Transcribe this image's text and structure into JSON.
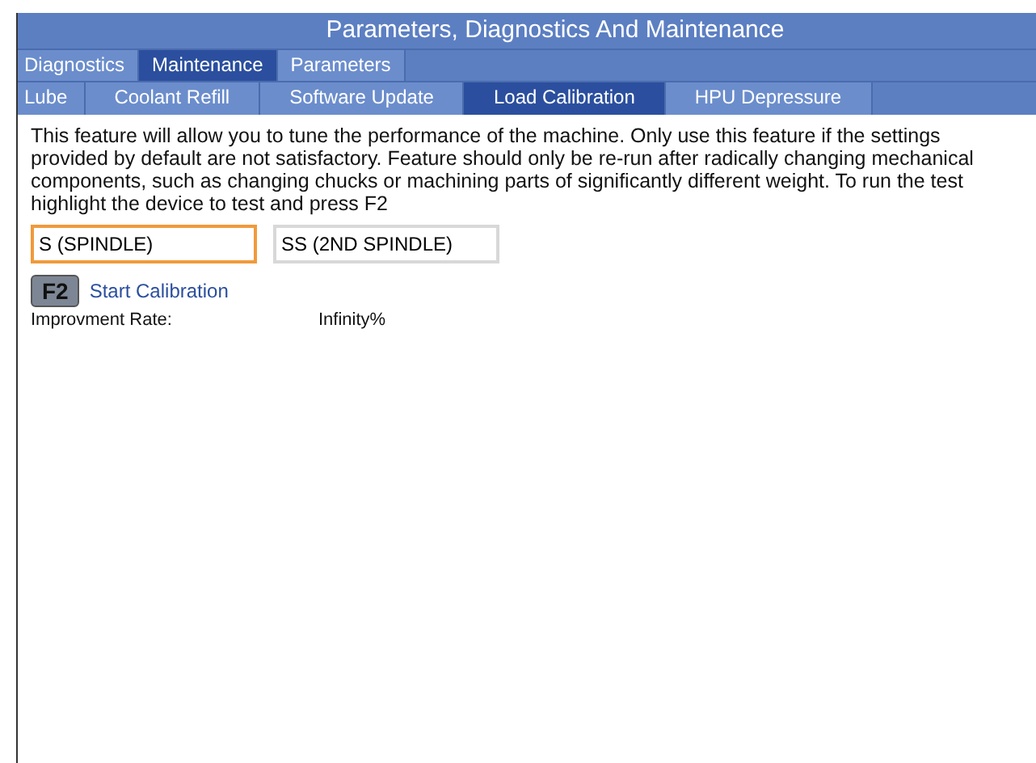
{
  "window": {
    "title": "Parameters, Diagnostics And Maintenance"
  },
  "tabs": [
    {
      "label": "Diagnostics",
      "selected": false
    },
    {
      "label": "Maintenance",
      "selected": true
    },
    {
      "label": "Parameters",
      "selected": false
    }
  ],
  "subtabs": [
    {
      "label": "Lube",
      "selected": false
    },
    {
      "label": "Coolant Refill",
      "selected": false
    },
    {
      "label": "Software Update",
      "selected": false
    },
    {
      "label": "Load Calibration",
      "selected": true
    },
    {
      "label": "HPU Depressure",
      "selected": false
    }
  ],
  "description": "This feature will allow you to tune the performance of the machine. Only use this feature if the settings provided by default are not satisfactory. Feature should only be re-run after radically changing mechanical components, such as changing chucks or machining parts of significantly different weight. To run the test highlight the device to test and press F2",
  "devices": [
    {
      "label": "S (SPINDLE)",
      "selected": true
    },
    {
      "label": "SS (2ND SPINDLE)",
      "selected": false
    }
  ],
  "action": {
    "key": "F2",
    "label": "Start Calibration"
  },
  "result": {
    "label": "Improvment Rate:",
    "value": "Infinity%"
  }
}
